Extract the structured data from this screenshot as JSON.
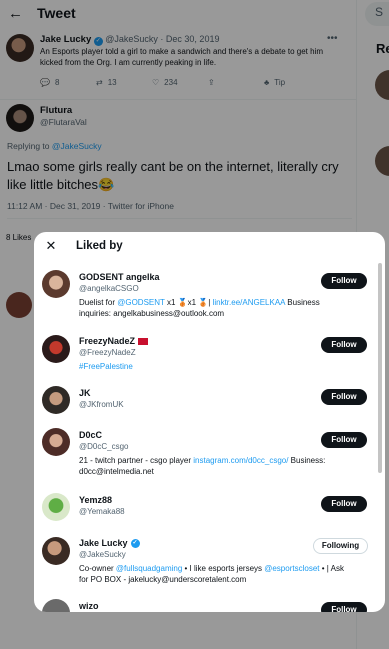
{
  "header": {
    "title": "Tweet"
  },
  "right": {
    "search_placeholder": "S",
    "heading": "Re"
  },
  "tweet1": {
    "name": "Jake Lucky",
    "meta": "@JakeSucky · Dec 30, 2019",
    "text": "An Esports player told a girl to make a sandwich and there's a debate to get him kicked from the Org. I am currently peaking in life.",
    "replies": "8",
    "retweets": "13",
    "likes": "234",
    "tip": "Tip"
  },
  "tweet2": {
    "name": "Flutura",
    "handle": "@FlutaraVal",
    "replying_prefix": "Replying to",
    "replying_to": "@JakeSucky",
    "body": "Lmao some girls really cant be on the internet, literally cry like little bitches😂",
    "timestamp": "11:12 AM · Dec 31, 2019 · Twitter for iPhone",
    "likes_stub": "8 Likes"
  },
  "modal": {
    "title": "Liked by",
    "users": [
      {
        "name": "GODSENT angelka",
        "handle": "@angelkaCSGO",
        "bio_pre": "Duelist for ",
        "bio_link1": "@GODSENT",
        "bio_mid": " x1 🥉x1 🥉| ",
        "bio_link2": "linktr.ee/ANGELKAA",
        "bio_post": " Business inquiries: angelkabusiness@outlook.com",
        "button": "Follow"
      },
      {
        "name": "FreezyNadeZ",
        "handle": "@FreezyNadeZ",
        "bio_link1": "#FreePalestine",
        "button": "Follow"
      },
      {
        "name": "JK",
        "handle": "@JKfromUK",
        "button": "Follow"
      },
      {
        "name": "D0cC",
        "handle": "@D0cC_csgo",
        "bio_pre": "21 - twitch partner - csgo player ",
        "bio_link1": "instagram.com/d0cc_csgo/",
        "bio_post": " Business: d0cc@intelmedia.net",
        "button": "Follow"
      },
      {
        "name": "Yemz88",
        "handle": "@Yemaka88",
        "button": "Follow"
      },
      {
        "name": "Jake Lucky",
        "handle": "@JakeSucky",
        "bio_pre": "Co-owner ",
        "bio_link1": "@fullsquadgaming",
        "bio_mid": " • I like esports jerseys ",
        "bio_link2": "@esportscloset",
        "bio_post": " • | Ask for PO BOX - jakelucky@underscoretalent.com",
        "button": "Following"
      },
      {
        "name": "wizo",
        "button": "Follow"
      }
    ]
  }
}
